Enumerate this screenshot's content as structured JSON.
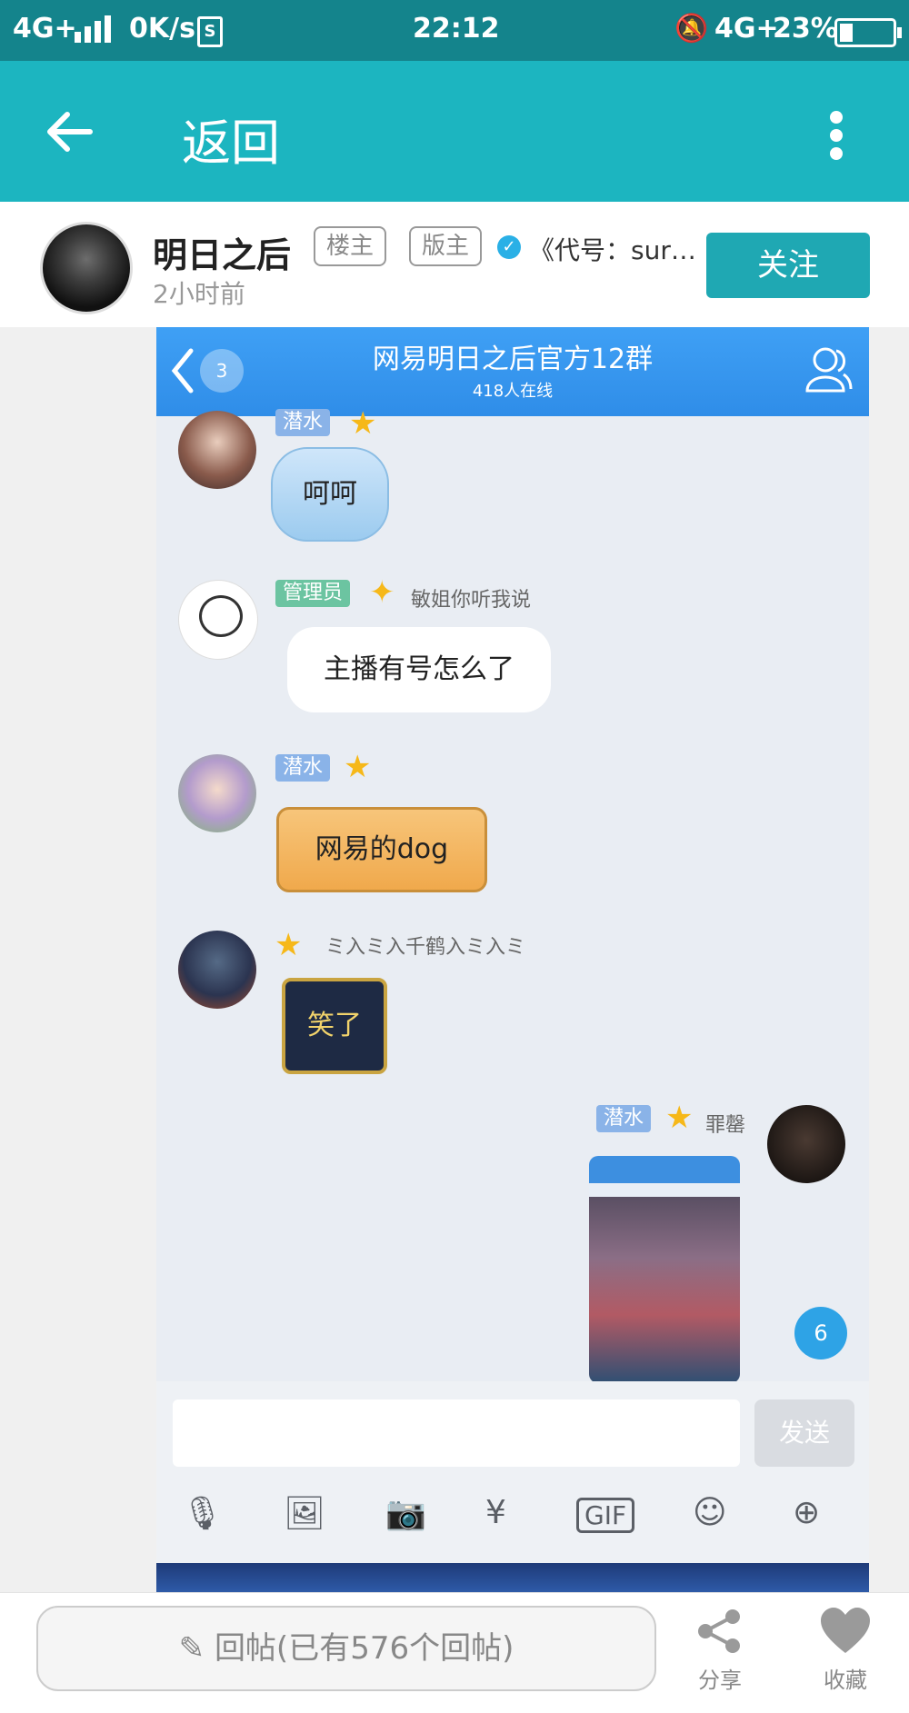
{
  "status_bar": {
    "network_left": "4G+",
    "speed": "0K/s",
    "time": "22:12",
    "network_right": "4G+",
    "battery": "23%"
  },
  "app_bar": {
    "back_label": "返回"
  },
  "author": {
    "name": "明日之后",
    "tag_owner": "楼主",
    "tag_moderator": "版主",
    "forum": "《代号：surviv...",
    "follow_label": "关注",
    "post_time": "2小时前"
  },
  "embedded_chat": {
    "back_count": "3",
    "group_title": "网易明日之后官方12群",
    "online_text": "418人在线",
    "messages": [
      {
        "badge": "潜水",
        "name": "",
        "text": "呵呵"
      },
      {
        "badge": "管理员",
        "name": "敏姐你听我说",
        "text": "主播有号怎么了"
      },
      {
        "badge": "潜水",
        "name": "",
        "text": "网易的dog"
      },
      {
        "badge": "",
        "name": "ミ入ミ入千鹤入ミ入ミ",
        "text": "笑了"
      },
      {
        "badge": "潜水",
        "name": "罪罄",
        "text": ""
      }
    ],
    "unread_count": "6",
    "send_label": "发送",
    "toolbar_icons": [
      "mic-icon",
      "image-icon",
      "camera-icon",
      "red-packet-icon",
      "gif-icon",
      "emoji-icon",
      "plus-icon"
    ]
  },
  "bottom_bar": {
    "reply_label": "回帖(已有576个回帖)",
    "share_label": "分享",
    "collect_label": "收藏"
  },
  "colors": {
    "app_bar": "#1cb5c0",
    "status_bar": "#14848c",
    "follow_button": "#1fa8b3",
    "chat_header": "#3fa0f5"
  }
}
